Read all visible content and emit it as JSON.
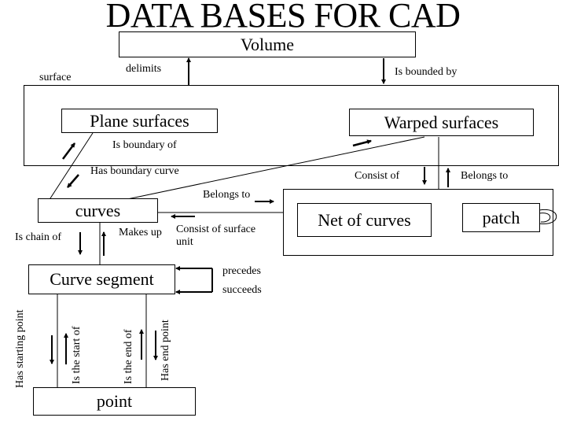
{
  "title": "DATA BASES FOR CAD",
  "nodes": {
    "volume": "Volume",
    "surface_group": "surface",
    "plane_surfaces": "Plane surfaces",
    "warped_surfaces": "Warped surfaces",
    "curves": "curves",
    "net_of_curves": "Net of curves",
    "patch": "patch",
    "curve_segment": "Curve segment",
    "point": "point"
  },
  "relations": {
    "delimits": "delimits",
    "is_bounded_by": "Is bounded by",
    "is_boundary_of": "Is boundary of",
    "has_boundary_curve": "Has boundary curve",
    "consist_of": "Consist of",
    "belongs_to_patch": "Belongs to",
    "belongs_to_net": "Belongs to",
    "consist_of_surface_unit": "Consist of surface unit",
    "is_chain_of": "Is chain of",
    "makes_up": "Makes up",
    "precedes": "precedes",
    "succeeds": "succeeds",
    "has_starting_point": "Has starting point",
    "is_the_start_of": "Is the start of",
    "is_the_end_of": "Is the end of",
    "has_end_point": "Has end point"
  }
}
